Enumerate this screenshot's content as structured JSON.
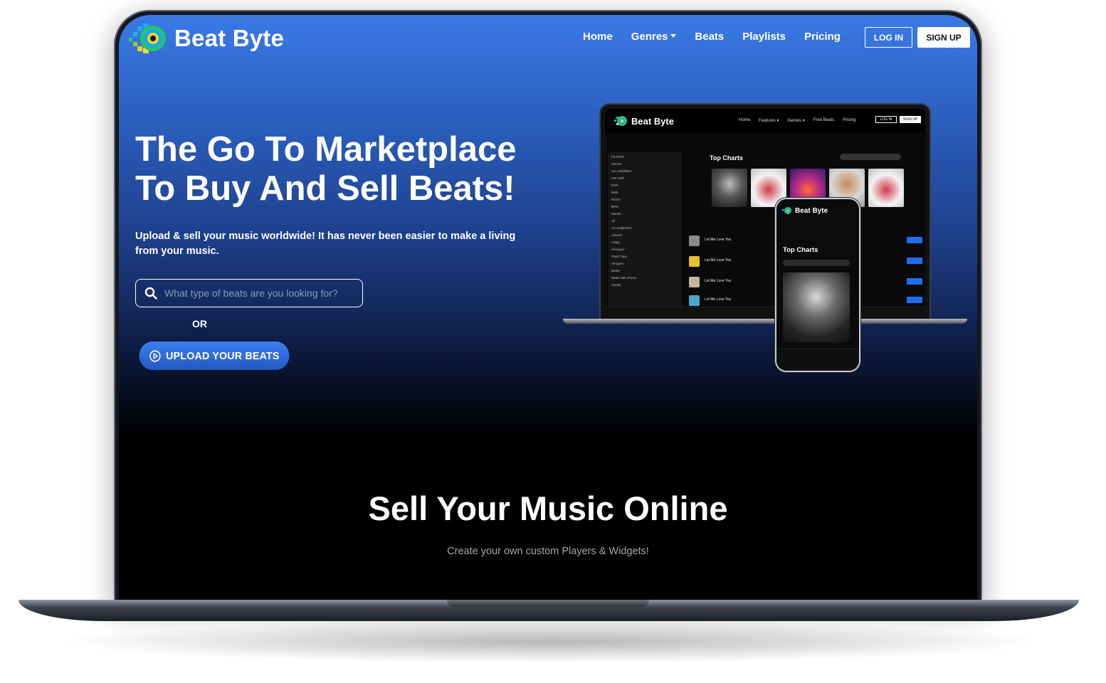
{
  "brand": {
    "name": "Beat Byte"
  },
  "nav": {
    "items": [
      {
        "label": "Home"
      },
      {
        "label": "Genres",
        "has_dropdown": true
      },
      {
        "label": "Beats"
      },
      {
        "label": "Playlists"
      },
      {
        "label": "Pricing"
      }
    ],
    "login_label": "LOG IN",
    "signup_label": "SIGN UP"
  },
  "hero": {
    "title_line1": "The Go To Marketplace",
    "title_line2": "To Buy And Sell Beats!",
    "subtitle": "Upload & sell your music worldwide! It has never been easier to make a living from your music.",
    "search_placeholder": "What type of beats are you looking for?",
    "or_label": "OR",
    "upload_label": "UPLOAD YOUR BEATS"
  },
  "mockup": {
    "laptop": {
      "brand": "Beat Byte",
      "menu": [
        "Home",
        "Features ▾",
        "Genres ▾",
        "Free Beats",
        "Pricing"
      ],
      "login": "LOG IN",
      "signup": "SIGN UP",
      "filters": [
        "FILTERS",
        "Genres",
        "ALL GENRES",
        "HIP HOP",
        "POP",
        "R&B",
        "ROCK",
        "BPM",
        "Moods",
        "All",
        "Accomplished",
        "Adored",
        "Angry",
        "Annoyed",
        "Track Type",
        "All types",
        "Beats",
        "Beats with chorus",
        "Vocals"
      ],
      "section_title": "Top Charts",
      "tracks": [
        "Let Me Love You",
        "Let Me Love You",
        "Let Me Love You",
        "Let Me Love You"
      ]
    },
    "phone": {
      "brand": "Beat Byte",
      "section_title": "Top Charts"
    }
  },
  "section2": {
    "title": "Sell Your Music Online",
    "subtitle": "Create your own custom Players & Widgets!"
  },
  "colors": {
    "gradient_top": "#3a7ae6",
    "gradient_bottom": "#000000",
    "button_blue": "#2d6ee0",
    "text_white": "#ffffff",
    "muted_text": "#a7a7a7"
  },
  "icons": [
    "search-icon",
    "play-circle-icon",
    "chevron-down-icon",
    "logo-mark-icon"
  ]
}
